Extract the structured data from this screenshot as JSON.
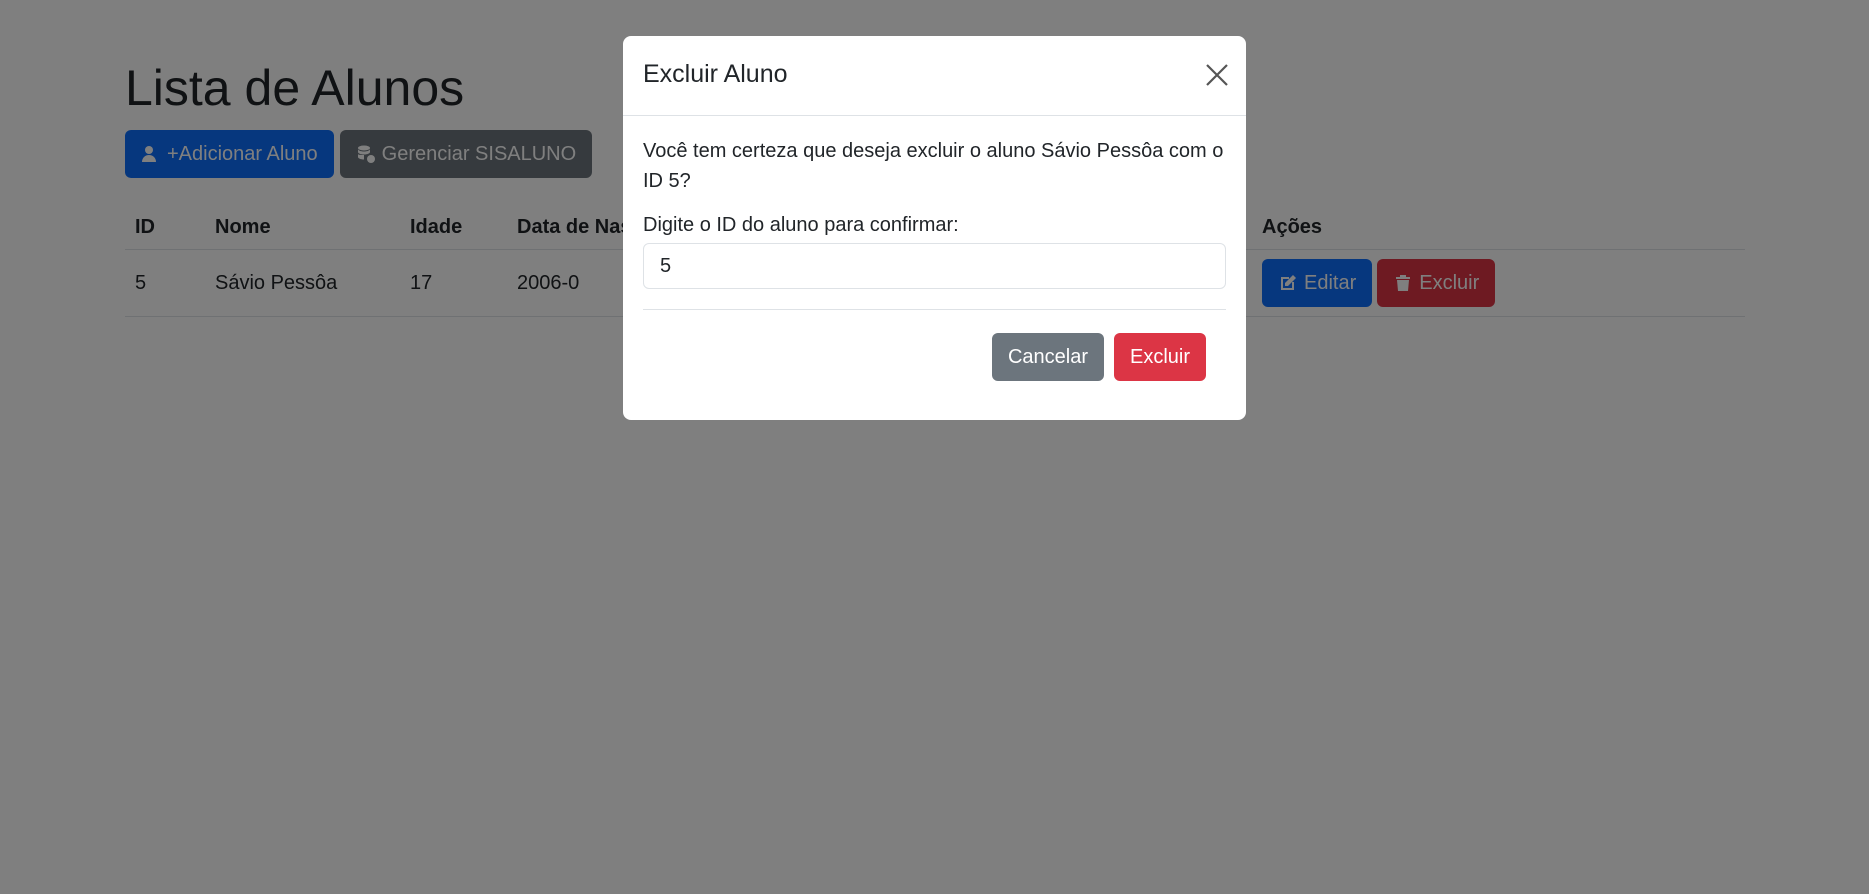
{
  "page": {
    "title": "Lista de Alunos",
    "add_button": "+Adicionar Aluno",
    "manage_button": "Gerenciar SISALUNO"
  },
  "table": {
    "headers": [
      "ID",
      "Nome",
      "Idade",
      "Data de Nascimento",
      "Ações"
    ],
    "rows": [
      {
        "id": "5",
        "nome": "Sávio Pessôa",
        "idade": "17",
        "data": "2006-0"
      }
    ],
    "edit_label": "Editar",
    "delete_label": "Excluir"
  },
  "modal": {
    "title": "Excluir Aluno",
    "message": "Você tem certeza que deseja excluir o aluno Sávio Pessôa com o ID 5?",
    "confirm_label": "Digite o ID do aluno para confirmar:",
    "input_value": "5",
    "cancel_label": "Cancelar",
    "delete_label": "Excluir"
  },
  "colors": {
    "primary": "#0d6efd",
    "secondary": "#6c757d",
    "danger": "#dc3545",
    "backdrop": "rgba(0,0,0,0.5)"
  },
  "icons": {
    "add": "user-plus-icon",
    "manage": "database-gear-icon",
    "edit": "pencil-square-icon",
    "delete": "trash-icon",
    "close": "close-icon"
  }
}
